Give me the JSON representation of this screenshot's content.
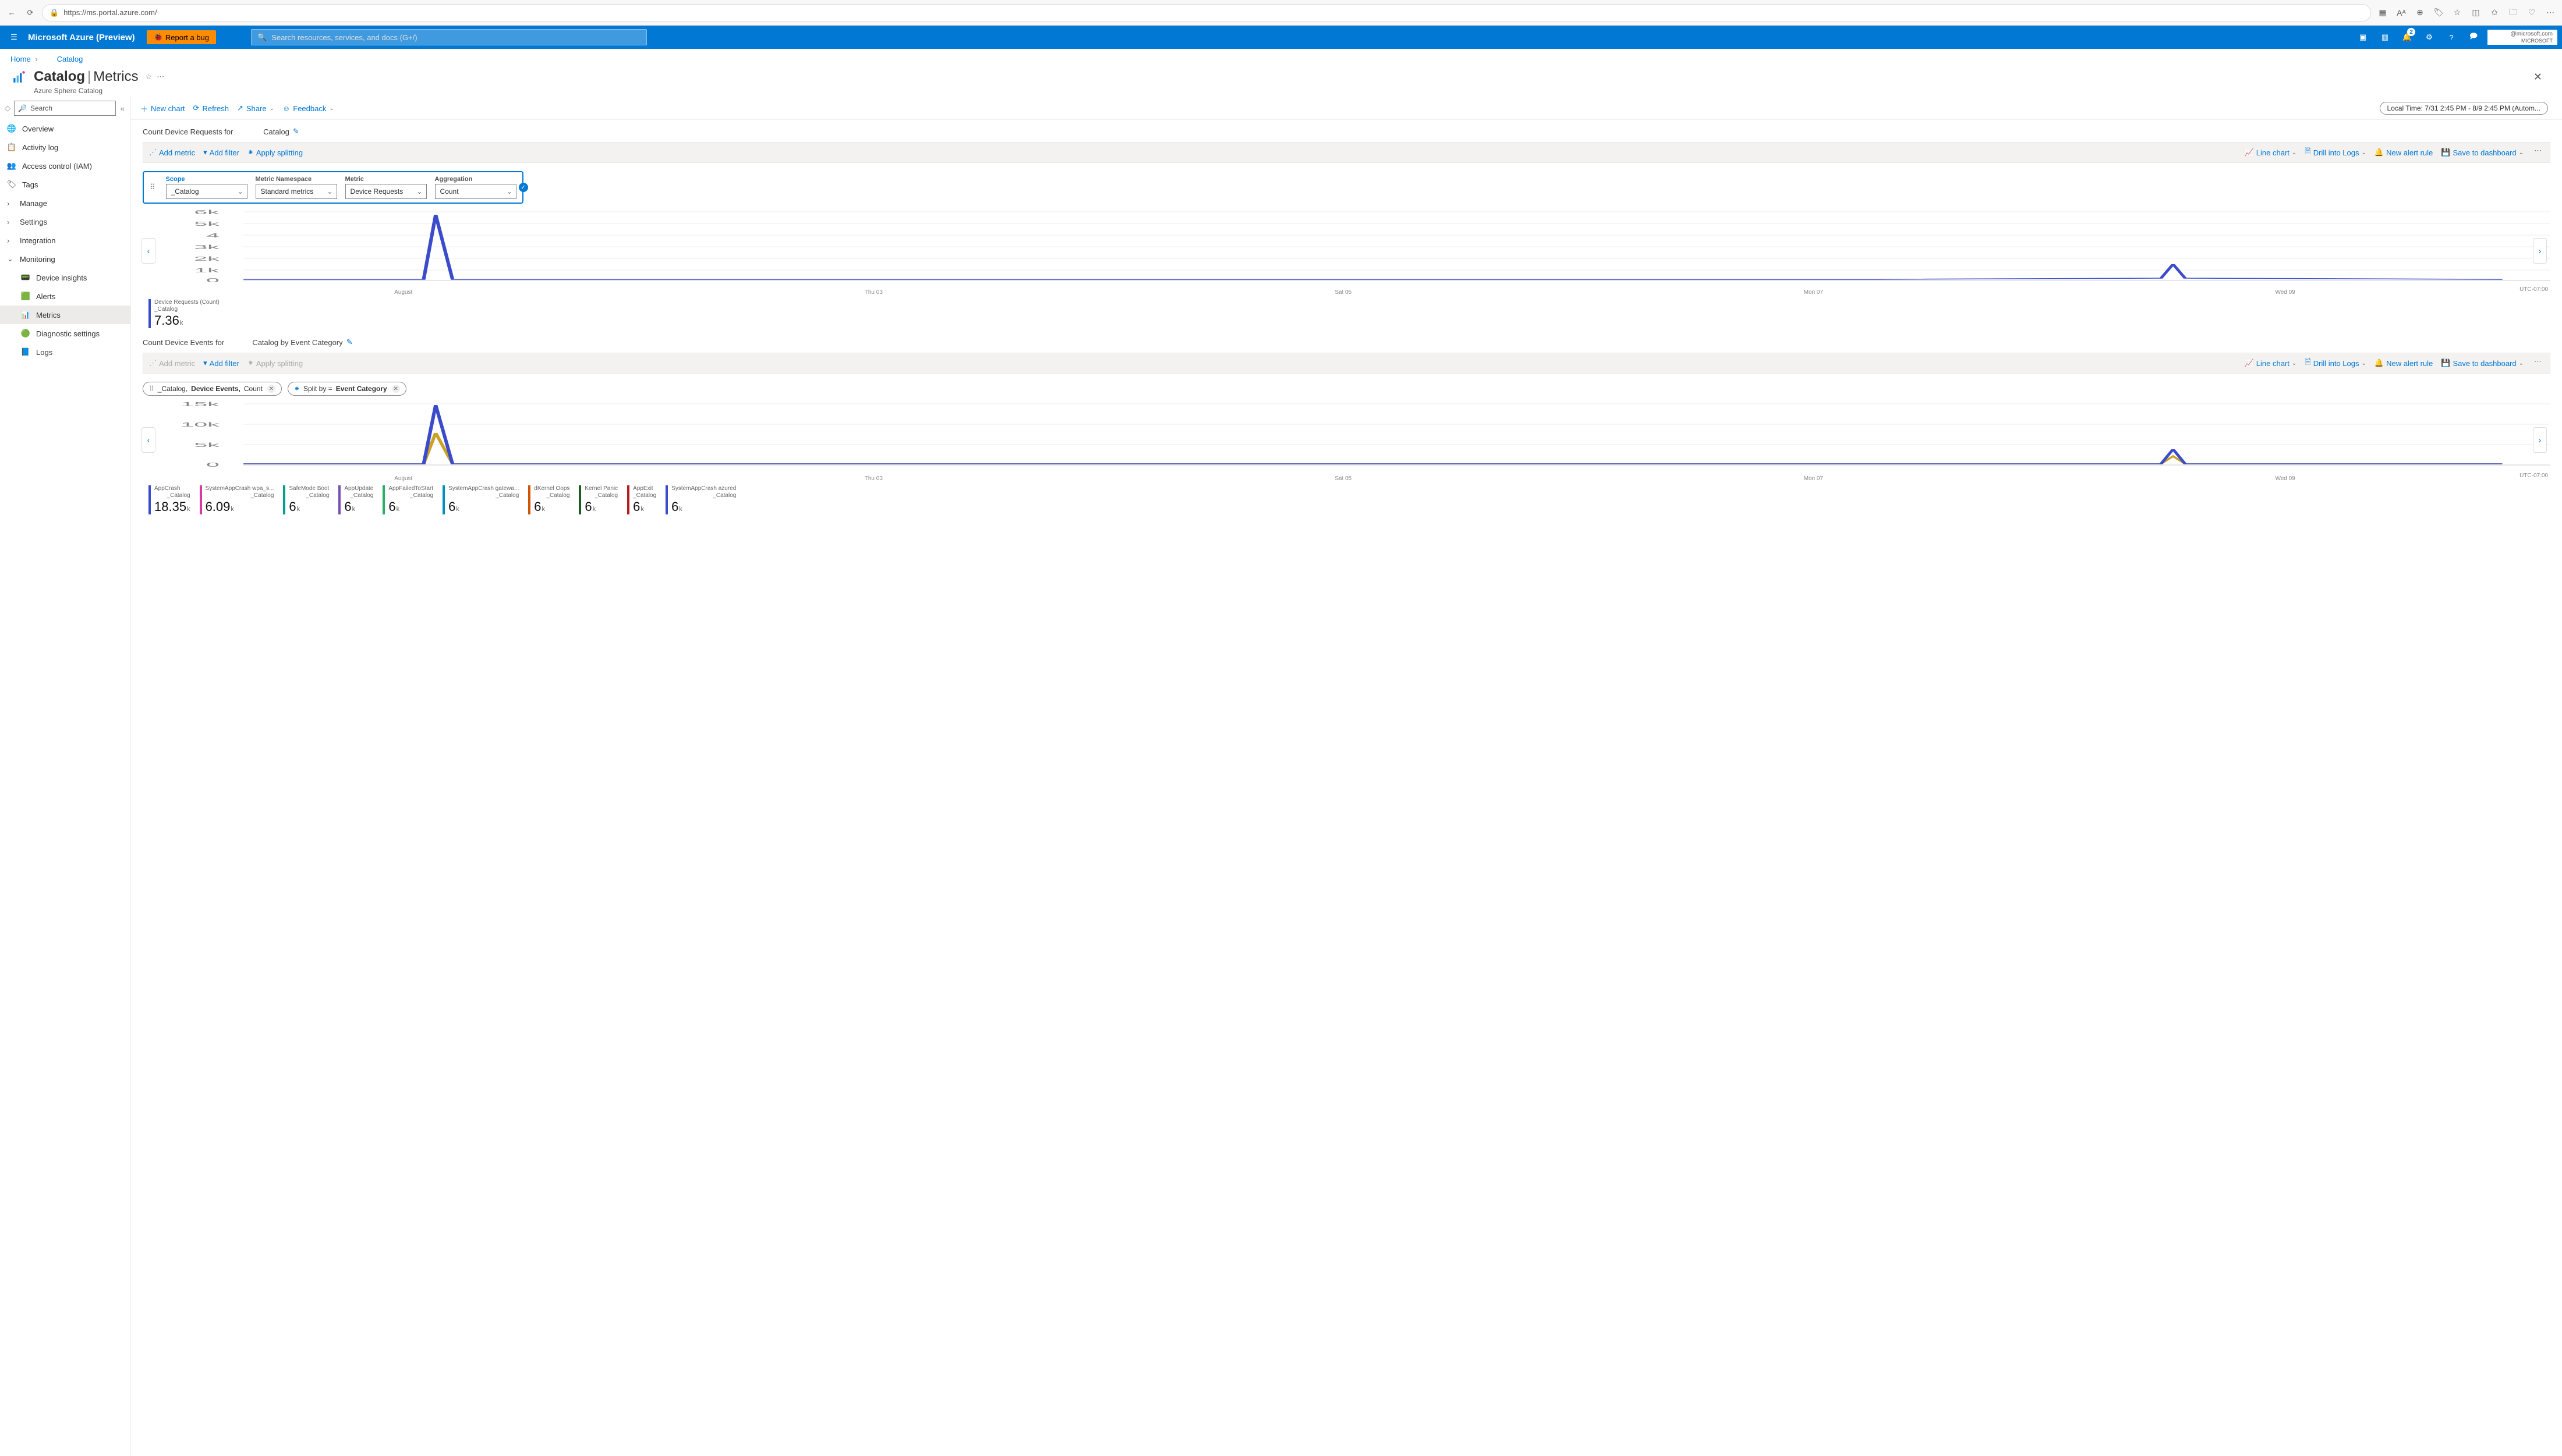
{
  "browser": {
    "url": "https://ms.portal.azure.com/"
  },
  "azure": {
    "brand": "Microsoft Azure (Preview)",
    "bug": "Report a bug",
    "search_ph": "Search resources, services, and docs (G+/)",
    "notif_count": "2",
    "user_domain": "@microsoft.com",
    "user_tenant": "MICROSOFT"
  },
  "crumbs": {
    "home": "Home",
    "catalog": "Catalog"
  },
  "title": {
    "main": "Catalog",
    "sub": "Metrics",
    "subtitle": "Azure Sphere Catalog"
  },
  "side": {
    "search_ph": "Search",
    "items": [
      {
        "label": "Overview"
      },
      {
        "label": "Activity log"
      },
      {
        "label": "Access control (IAM)"
      },
      {
        "label": "Tags"
      },
      {
        "label": "Manage"
      },
      {
        "label": "Settings"
      },
      {
        "label": "Integration"
      },
      {
        "label": "Monitoring"
      },
      {
        "label": "Device insights"
      },
      {
        "label": "Alerts"
      },
      {
        "label": "Metrics"
      },
      {
        "label": "Diagnostic settings"
      },
      {
        "label": "Logs"
      }
    ]
  },
  "toolbar": {
    "new": "New chart",
    "refresh": "Refresh",
    "share": "Share",
    "feedback": "Feedback",
    "time": "Local Time: 7/31 2:45 PM - 8/9 2:45 PM (Autom..."
  },
  "chart1": {
    "title_pre": "Count Device Requests for",
    "title_post": "Catalog",
    "toolbar": {
      "add_metric": "Add metric",
      "add_filter": "Add filter",
      "apply_splitting": "Apply splitting",
      "line_chart": "Line chart",
      "drill_logs": "Drill into Logs",
      "new_alert": "New alert rule",
      "save_dash": "Save to dashboard"
    },
    "picker": {
      "scope_lbl": "Scope",
      "scope_val": "_Catalog",
      "ns_lbl": "Metric Namespace",
      "ns_val": "Standard metrics",
      "metric_lbl": "Metric",
      "metric_val": "Device Requests",
      "agg_lbl": "Aggregation",
      "agg_val": "Count"
    },
    "yaxis": [
      "6k",
      "5k",
      "4",
      "3k",
      "2k",
      "1k",
      "0"
    ],
    "xaxis": [
      "August",
      "Thu 03",
      "Sat 05",
      "Mon 07",
      "Wed 09"
    ],
    "tz": "UTC-07:00",
    "legend": {
      "name": "Device Requests (Count)",
      "sub": "_Catalog",
      "value": "7.36",
      "unit": "k",
      "color": "#3b4cca"
    }
  },
  "chart2": {
    "title_pre": "Count Device Events for",
    "title_post": "Catalog by Event Category",
    "pill_main_pre": "_Catalog,",
    "pill_main_mid": "Device Events,",
    "pill_main_post": " Count",
    "pill_split_pre": "Split by = ",
    "pill_split_val": "Event Category",
    "yaxis": [
      "15k",
      "10k",
      "5k",
      "0"
    ],
    "xaxis": [
      "August",
      "Thu 03",
      "Sat 05",
      "Mon 07",
      "Wed 09"
    ],
    "tz": "UTC-07:00",
    "legend": [
      {
        "name": "AppCrash",
        "sub": "_Catalog",
        "value": "18.35",
        "unit": "k",
        "color": "#3b4cca"
      },
      {
        "name": "SystemAppCrash wpa_s...",
        "sub": "_Catalog",
        "value": "6.09",
        "unit": "k",
        "color": "#d83b9d"
      },
      {
        "name": "SafeMode Boot",
        "sub": "_Catalog",
        "value": "6",
        "unit": "k",
        "color": "#009e8f"
      },
      {
        "name": "AppUpdate",
        "sub": "_Catalog",
        "value": "6",
        "unit": "k",
        "color": "#7a4fb5"
      },
      {
        "name": "AppFailedToStart",
        "sub": "_Catalog",
        "value": "6",
        "unit": "k",
        "color": "#27ae60"
      },
      {
        "name": "SystemAppCrash gatewa...",
        "sub": "_Catalog",
        "value": "6",
        "unit": "k",
        "color": "#0090c0"
      },
      {
        "name": "dKernel Oops",
        "sub": "_Catalog",
        "value": "6",
        "unit": "k",
        "color": "#d35400"
      },
      {
        "name": "Kernel Panic",
        "sub": "_Catalog",
        "value": "6",
        "unit": "k",
        "color": "#1b5e20"
      },
      {
        "name": "AppExit",
        "sub": "_Catalog",
        "value": "6",
        "unit": "k",
        "color": "#b71c1c"
      },
      {
        "name": "SystemAppCrash azured",
        "sub": "_Catalog",
        "value": "6",
        "unit": "k",
        "color": "#3b4cca"
      }
    ]
  },
  "chart_data": [
    {
      "type": "line",
      "title": "Count Device Requests for Catalog",
      "x": [
        "Jul 31",
        "Aug 01",
        "Aug 02",
        "Aug 03",
        "Aug 04",
        "Aug 05",
        "Aug 06",
        "Aug 07",
        "Aug 08",
        "Aug 09"
      ],
      "series": [
        {
          "name": "Device Requests (Count)",
          "values": [
            100,
            5500,
            100,
            100,
            100,
            100,
            100,
            100,
            1200,
            100
          ]
        }
      ],
      "ylabel": "",
      "ylim": [
        0,
        6000
      ]
    },
    {
      "type": "line",
      "title": "Count Device Events for Catalog by Event Category",
      "x": [
        "Jul 31",
        "Aug 01",
        "Aug 02",
        "Aug 03",
        "Aug 04",
        "Aug 05",
        "Aug 06",
        "Aug 07",
        "Aug 08",
        "Aug 09"
      ],
      "series": [
        {
          "name": "AppCrash",
          "values": [
            0,
            14000,
            0,
            0,
            0,
            0,
            0,
            0,
            2000,
            0
          ]
        },
        {
          "name": "SystemAppCrash wpa_s",
          "values": [
            0,
            4000,
            0,
            0,
            0,
            0,
            0,
            0,
            800,
            0
          ]
        }
      ],
      "ylabel": "",
      "ylim": [
        0,
        15000
      ]
    }
  ]
}
